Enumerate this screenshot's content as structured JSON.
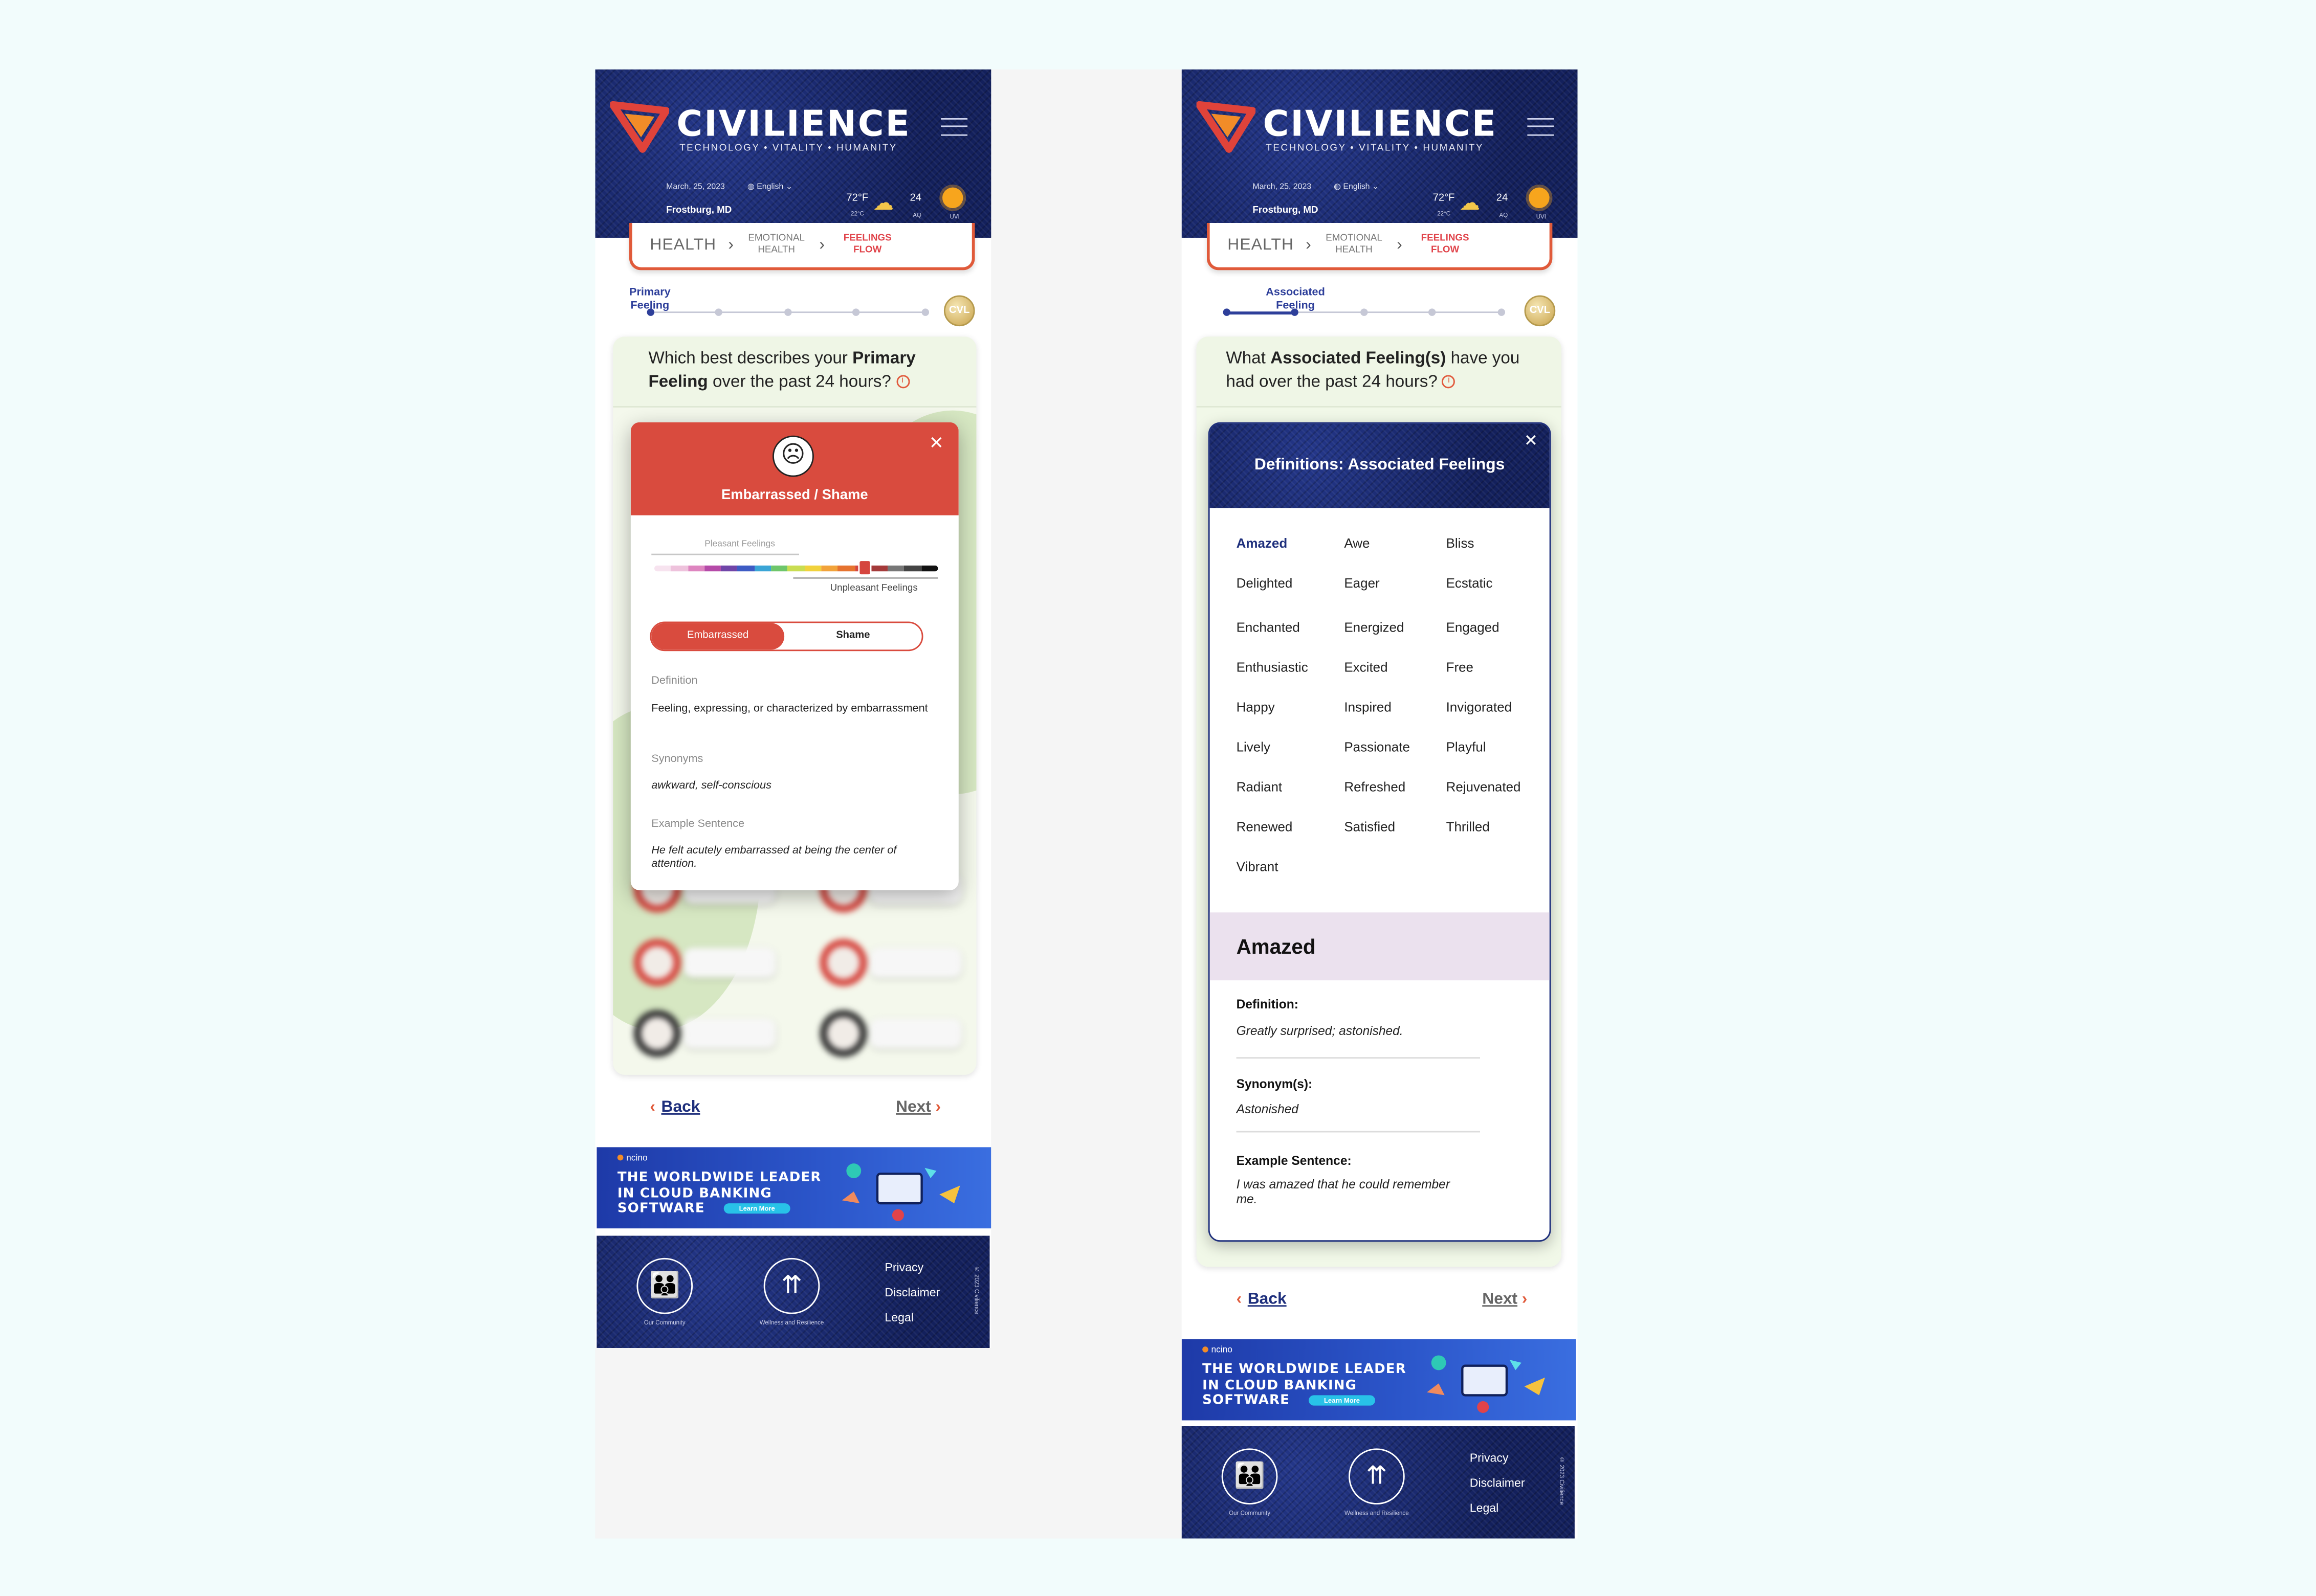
{
  "header": {
    "brand": "CIVILIENCE",
    "tagline": "TECHNOLOGY • VITALITY • HUMANITY",
    "date": "March, 25, 2023",
    "language": "English",
    "location": "Frostburg, MD",
    "temp_f": "72°F",
    "temp_c": "22°C",
    "aqi_value": "24",
    "aqi_label": "AQ",
    "uv_value": "6",
    "uv_label": "UVI"
  },
  "breadcrumb": {
    "level1": "HEALTH",
    "level2": "EMOTIONAL HEALTH",
    "level3": "FEELINGS FLOW"
  },
  "left": {
    "progress_label": "Primary Feeling",
    "progress_step": 1,
    "progress_total": 5,
    "cvl": "CVL",
    "question_pre": "Which best describes your ",
    "question_bold": "Primary Feeling",
    "question_post": " over the past 24 hours?",
    "modal": {
      "title": "Embarrassed / Shame",
      "face_icon": "embarrassed-face-icon",
      "scale_top": "Pleasant Feelings",
      "scale_bottom": "Unpleasant Feelings",
      "scale_position": 0.78,
      "toggle_on": "Embarrassed",
      "toggle_off": "Shame",
      "definition_label": "Definition",
      "definition_text": "Feeling, expressing, or characterized by embarrassment",
      "synonyms_label": "Synonyms",
      "synonyms_text": "awkward, self-conscious",
      "example_label": "Example Sentence",
      "example_text": "He felt acutely embarrassed at being the center of attention."
    }
  },
  "right": {
    "progress_label": "Associated Feeling",
    "progress_step": 2,
    "progress_total": 5,
    "cvl": "CVL",
    "question_pre": "What ",
    "question_bold": "Associated Feeling(s)",
    "question_post": " have you had over the past 24 hours?",
    "modal": {
      "title": "Definitions:  Associated Feelings",
      "words": [
        "Amazed",
        "Awe",
        "Bliss",
        "Delighted",
        "Eager",
        "Ecstatic",
        "Enchanted",
        "Energized",
        "Engaged",
        "Enthusiastic",
        "Excited",
        "Free",
        "Happy",
        "Inspired",
        "Invigorated",
        "Lively",
        "Passionate",
        "Playful",
        "Radiant",
        "Refreshed",
        "Rejuvenated",
        "Renewed",
        "Satisfied",
        "Thrilled",
        "Vibrant"
      ],
      "selected_word": "Amazed",
      "definition_label": "Definition:",
      "definition_text": "Greatly surprised; astonished.",
      "synonyms_label": "Synonym(s):",
      "synonyms_text": "Astonished",
      "example_label": "Example Sentence:",
      "example_text": "I was amazed that he could remember me."
    }
  },
  "nav": {
    "back": "Back",
    "next": "Next"
  },
  "ad": {
    "brand": "ncino",
    "line1": "THE WORLDWIDE LEADER",
    "line2": "IN CLOUD BANKING",
    "line3": "SOFTWARE",
    "cta": "Learn More"
  },
  "footer": {
    "community": "Our Community",
    "wellness": "Wellness and Resilience",
    "privacy": "Privacy",
    "disclaimer": "Disclaimer",
    "legal": "Legal",
    "copyright": "© 2023 Civilience"
  },
  "colors": {
    "navy": "#17266b",
    "accent": "#e05a3a",
    "danger": "#d94b3e",
    "green_card": "#f1f8e8",
    "selected_band": "#ebe1ee"
  }
}
